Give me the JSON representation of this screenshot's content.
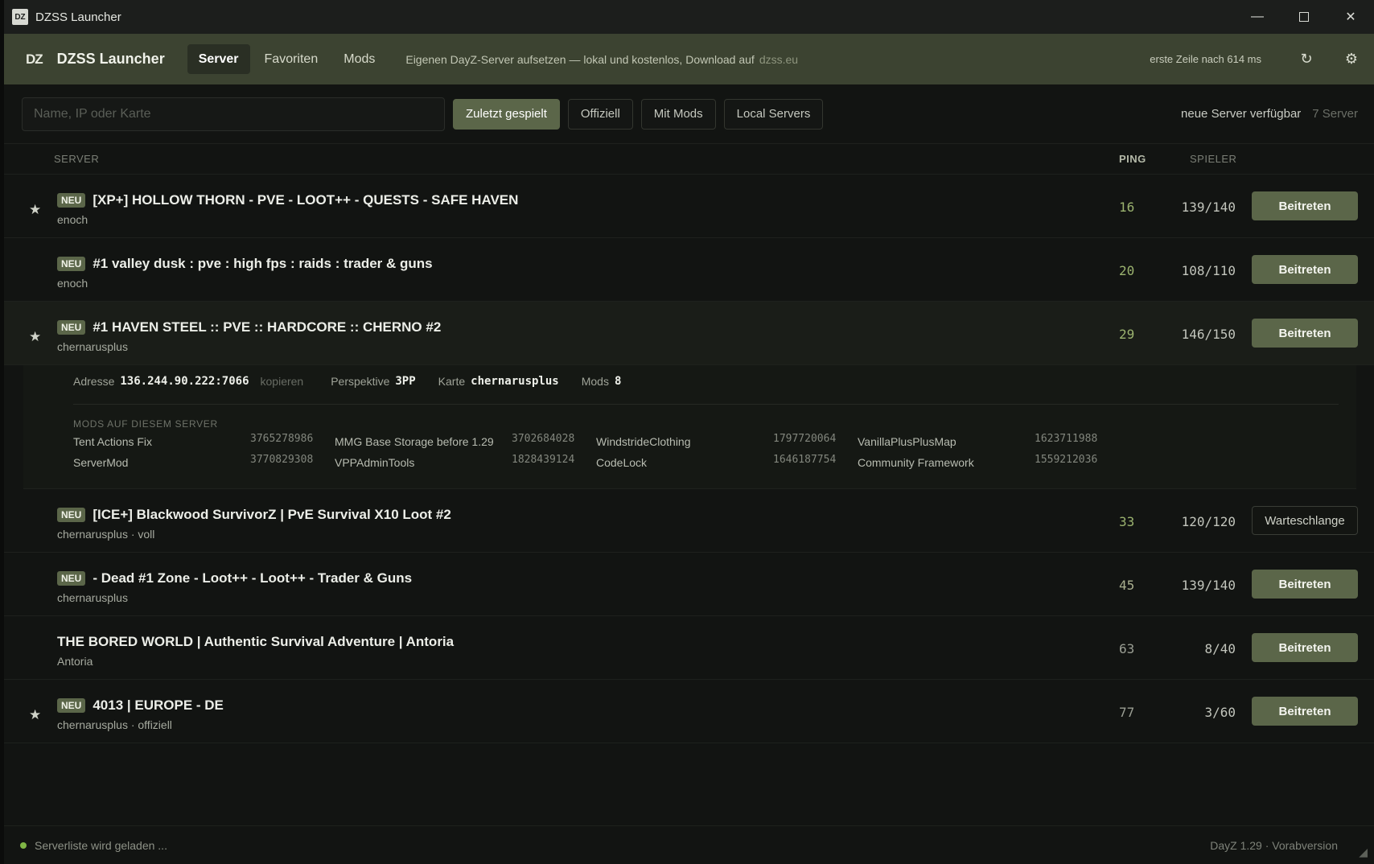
{
  "window": {
    "logo": "DZ",
    "title": "DZSS Launcher"
  },
  "header": {
    "logo": "DZ",
    "brand": "DZSS Launcher",
    "tabs": [
      {
        "label": "Server",
        "active": true
      },
      {
        "label": "Favoriten",
        "active": false
      },
      {
        "label": "Mods",
        "active": false
      }
    ],
    "promo": "Eigenen DayZ-Server aufsetzen — lokal und kostenlos, Download auf",
    "promo_link": "dzss.eu",
    "first_line": "erste Zeile nach 614 ms"
  },
  "toolbar": {
    "search_placeholder": "Name, IP oder Karte",
    "filters": [
      {
        "label": "Zuletzt gespielt",
        "active": true
      },
      {
        "label": "Offiziell",
        "active": false
      },
      {
        "label": "Mit Mods",
        "active": false
      },
      {
        "label": "Local Servers",
        "active": false
      }
    ],
    "new_available": "neue Server verfügbar",
    "count": "7 Server"
  },
  "columns": {
    "server": "SERVER",
    "ping": "PING",
    "players": "SPIELER"
  },
  "servers": [
    {
      "badge": "NEU",
      "name": "[XP+] HOLLOW THORN - PVE - LOOT++ - QUESTS - SAFE HAVEN",
      "sub": "enoch",
      "ping": "16",
      "players": "139/140",
      "action": "Beitreten",
      "favorite": true
    },
    {
      "badge": "NEU",
      "name": "#1 valley dusk : pve : high fps : raids : trader & guns",
      "sub": "enoch",
      "ping": "20",
      "players": "108/110",
      "action": "Beitreten",
      "favorite": false
    },
    {
      "badge": "NEU",
      "name": "#1 HAVEN STEEL :: PVE :: HARDCORE :: CHERNO #2",
      "sub": "chernarusplus",
      "ping": "29",
      "players": "146/150",
      "action": "Beitreten",
      "favorite": true
    },
    {
      "badge": "NEU",
      "name": "[ICE+] Blackwood SurvivorZ | PvE Survival X10 Loot #2",
      "sub": "chernarusplus · voll",
      "ping": "33",
      "players": "120/120",
      "action": "Warteschlange",
      "favorite": false
    },
    {
      "badge": "NEU",
      "name": "- Dead #1 Zone - Loot++ - Loot++ - Trader & Guns",
      "sub": "chernarusplus",
      "ping": "45",
      "players": "139/140",
      "action": "Beitreten",
      "favorite": false
    },
    {
      "badge": "",
      "name": "THE BORED WORLD | Authentic Survival Adventure | Antoria",
      "sub": "Antoria",
      "ping": "63",
      "players": "8/40",
      "action": "Beitreten",
      "favorite": false
    },
    {
      "badge": "NEU",
      "name": "4013 | EUROPE - DE",
      "sub": "chernarusplus · offiziell",
      "ping": "77",
      "players": "3/60",
      "action": "Beitreten",
      "favorite": true
    }
  ],
  "details": {
    "address_label": "Adresse",
    "address": "136.244.90.222:7066",
    "copy": "kopieren",
    "perspective_label": "Perspektive",
    "perspective": "3PP",
    "map_label": "Karte",
    "map": "chernarusplus",
    "mods_label": "Mods",
    "mods_count": "8",
    "mods_title": "MODS AUF DIESEM SERVER",
    "mods": [
      {
        "name": "Tent Actions Fix",
        "id": "3765278986"
      },
      {
        "name": "ServerMod",
        "id": "3770829308"
      },
      {
        "name": "MMG Base Storage before 1.29",
        "id": "3702684028"
      },
      {
        "name": "VPPAdminTools",
        "id": "1828439124"
      },
      {
        "name": "WindstrideClothing",
        "id": "1797720064"
      },
      {
        "name": "CodeLock",
        "id": "1646187754"
      },
      {
        "name": "VanillaPlusPlusMap",
        "id": "1623711988"
      },
      {
        "name": "Community Framework",
        "id": "1559212036"
      }
    ]
  },
  "status": {
    "text": "Serverliste wird geladen ...",
    "version": "DayZ 1.29 · Vorabversion"
  },
  "colors": {
    "accent": "#5b6649",
    "header": "#3c4331",
    "ping_good": "#9bb36f",
    "status_dot": "#7fb545"
  }
}
